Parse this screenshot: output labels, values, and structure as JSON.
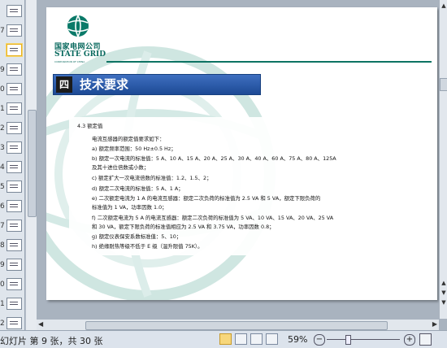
{
  "thumbnails": [
    {
      "num": ""
    },
    {
      "num": "7"
    },
    {
      "num": ""
    },
    {
      "num": "9"
    },
    {
      "num": "0"
    },
    {
      "num": "1"
    },
    {
      "num": "2"
    },
    {
      "num": "3"
    },
    {
      "num": "4"
    },
    {
      "num": "5"
    },
    {
      "num": "6"
    },
    {
      "num": "7"
    },
    {
      "num": "8"
    },
    {
      "num": "9"
    },
    {
      "num": "0"
    },
    {
      "num": "1"
    },
    {
      "num": "2"
    },
    {
      "num": "3"
    }
  ],
  "status": {
    "slide_count": "幻灯片 第 9 张，共 30 张",
    "zoom": "59%"
  },
  "slide": {
    "logo": {
      "name_cn": "国家电网公司",
      "name_en": "STATE GRID",
      "subtitle": "CORPORATION OF CHINA"
    },
    "heading": {
      "number": "四",
      "title": "技术要求"
    },
    "lines": [
      "4.3   额定值",
      "电流互感器的额定值要求如下：",
      "a)   额定频率范围：50 Hz±0.5 Hz；",
      "b)   额定一次电流的标准值：5 A、10 A、15 A、20 A、25 A、30 A、40 A、60 A、75 A、80 A、125A",
      "及其十进位倍数或小数；",
      "c)   额定扩大一次电流倍数的标准值：1.2、1.5、2；",
      "d)   额定二次电流的标准值：5 A、1 A；",
      "e)   二次额定电流为 1 A 的电流互感器：额定二次负荷的标准值为 2.5 VA 和 5 VA，额定下限负荷的",
      "标准值为 1 VA，功率因数 1.0；",
      "f)   二次额定电流为 5 A 的电流互感器：额定二次负荷的标准值为 5 VA、10 VA、15 VA、20 VA、25 VA",
      "和 30 VA，额定下限负荷的标准值相应为 2.5 VA 和 3.75 VA，功率因数 0.8；",
      "g)   额定仪表保安系数标准值：5、10；",
      "h)   绝缘耐热等级不低于 E 级（温升限值 75K）。"
    ]
  }
}
